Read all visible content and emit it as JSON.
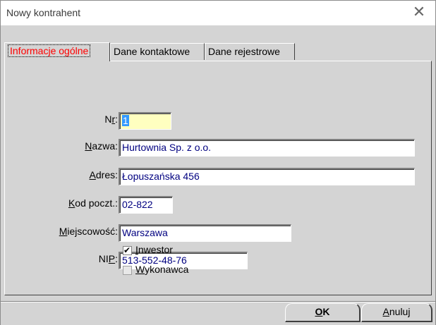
{
  "window": {
    "title": "Nowy kontrahent",
    "close_glyph": "✕"
  },
  "tabs": [
    {
      "label": "Informacje ogólne",
      "active": true
    },
    {
      "label": "Dane kontaktowe",
      "active": false
    },
    {
      "label": "Dane rejestrowe",
      "active": false
    }
  ],
  "form": {
    "nr": {
      "label_pre": "N",
      "label_acc": "r",
      "label_post": ":",
      "value": "1"
    },
    "nazwa": {
      "label_pre": "",
      "label_acc": "N",
      "label_post": "azwa:",
      "value": "Hurtownia Sp. z o.o."
    },
    "adres": {
      "label_pre": "",
      "label_acc": "A",
      "label_post": "dres:",
      "value": "Łopuszańska 456"
    },
    "kod": {
      "label_pre": "",
      "label_acc": "K",
      "label_post": "od poczt.:",
      "value": "02-822"
    },
    "miejscowosc": {
      "label_pre": "",
      "label_acc": "M",
      "label_post": "iejscowość:",
      "value": "Warszawa"
    },
    "nip": {
      "label_pre": "NI",
      "label_acc": "P",
      "label_post": ":",
      "value": "513-552-48-76"
    },
    "inwestor": {
      "label_acc": "I",
      "label_post": "nwestor",
      "checked": true
    },
    "wykonawca": {
      "label_acc": "W",
      "label_post": "ykonawca",
      "checked": false
    }
  },
  "buttons": {
    "ok": {
      "acc": "O",
      "post": "K"
    },
    "cancel": {
      "acc": "A",
      "post": "nuluj"
    }
  },
  "colors": {
    "active_tab": "#ff0000",
    "input_text": "#000080",
    "selection": "#3399ff",
    "nr_bg": "#ffffc0"
  }
}
